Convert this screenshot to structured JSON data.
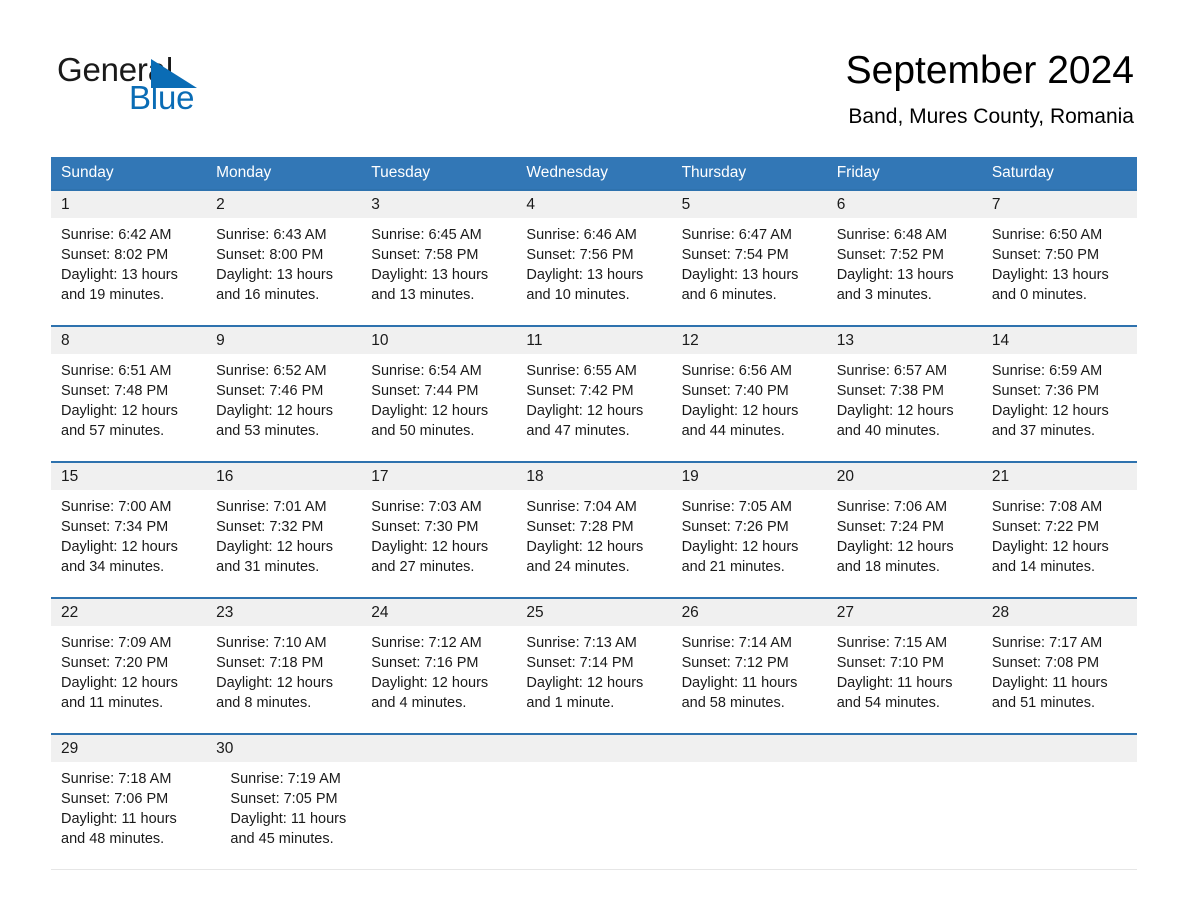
{
  "brand": {
    "name_part1": "General",
    "name_part2": "Blue",
    "triangle_color": "#0a6cb5"
  },
  "header": {
    "title": "September 2024",
    "subtitle": "Band, Mures County, Romania"
  },
  "theme": {
    "header_blue": "#3277b6",
    "rule_blue": "#2e72ae",
    "daynum_band": "#f0f0f0"
  },
  "weekdays": [
    "Sunday",
    "Monday",
    "Tuesday",
    "Wednesday",
    "Thursday",
    "Friday",
    "Saturday"
  ],
  "weeks": [
    {
      "days": [
        {
          "date": "1",
          "sunrise": "Sunrise: 6:42 AM",
          "sunset": "Sunset: 8:02 PM",
          "daylight_line1": "Daylight: 13 hours",
          "daylight_line2": "and 19 minutes."
        },
        {
          "date": "2",
          "sunrise": "Sunrise: 6:43 AM",
          "sunset": "Sunset: 8:00 PM",
          "daylight_line1": "Daylight: 13 hours",
          "daylight_line2": "and 16 minutes."
        },
        {
          "date": "3",
          "sunrise": "Sunrise: 6:45 AM",
          "sunset": "Sunset: 7:58 PM",
          "daylight_line1": "Daylight: 13 hours",
          "daylight_line2": "and 13 minutes."
        },
        {
          "date": "4",
          "sunrise": "Sunrise: 6:46 AM",
          "sunset": "Sunset: 7:56 PM",
          "daylight_line1": "Daylight: 13 hours",
          "daylight_line2": "and 10 minutes."
        },
        {
          "date": "5",
          "sunrise": "Sunrise: 6:47 AM",
          "sunset": "Sunset: 7:54 PM",
          "daylight_line1": "Daylight: 13 hours",
          "daylight_line2": "and 6 minutes."
        },
        {
          "date": "6",
          "sunrise": "Sunrise: 6:48 AM",
          "sunset": "Sunset: 7:52 PM",
          "daylight_line1": "Daylight: 13 hours",
          "daylight_line2": "and 3 minutes."
        },
        {
          "date": "7",
          "sunrise": "Sunrise: 6:50 AM",
          "sunset": "Sunset: 7:50 PM",
          "daylight_line1": "Daylight: 13 hours",
          "daylight_line2": "and 0 minutes."
        }
      ]
    },
    {
      "days": [
        {
          "date": "8",
          "sunrise": "Sunrise: 6:51 AM",
          "sunset": "Sunset: 7:48 PM",
          "daylight_line1": "Daylight: 12 hours",
          "daylight_line2": "and 57 minutes."
        },
        {
          "date": "9",
          "sunrise": "Sunrise: 6:52 AM",
          "sunset": "Sunset: 7:46 PM",
          "daylight_line1": "Daylight: 12 hours",
          "daylight_line2": "and 53 minutes."
        },
        {
          "date": "10",
          "sunrise": "Sunrise: 6:54 AM",
          "sunset": "Sunset: 7:44 PM",
          "daylight_line1": "Daylight: 12 hours",
          "daylight_line2": "and 50 minutes."
        },
        {
          "date": "11",
          "sunrise": "Sunrise: 6:55 AM",
          "sunset": "Sunset: 7:42 PM",
          "daylight_line1": "Daylight: 12 hours",
          "daylight_line2": "and 47 minutes."
        },
        {
          "date": "12",
          "sunrise": "Sunrise: 6:56 AM",
          "sunset": "Sunset: 7:40 PM",
          "daylight_line1": "Daylight: 12 hours",
          "daylight_line2": "and 44 minutes."
        },
        {
          "date": "13",
          "sunrise": "Sunrise: 6:57 AM",
          "sunset": "Sunset: 7:38 PM",
          "daylight_line1": "Daylight: 12 hours",
          "daylight_line2": "and 40 minutes."
        },
        {
          "date": "14",
          "sunrise": "Sunrise: 6:59 AM",
          "sunset": "Sunset: 7:36 PM",
          "daylight_line1": "Daylight: 12 hours",
          "daylight_line2": "and 37 minutes."
        }
      ]
    },
    {
      "days": [
        {
          "date": "15",
          "sunrise": "Sunrise: 7:00 AM",
          "sunset": "Sunset: 7:34 PM",
          "daylight_line1": "Daylight: 12 hours",
          "daylight_line2": "and 34 minutes."
        },
        {
          "date": "16",
          "sunrise": "Sunrise: 7:01 AM",
          "sunset": "Sunset: 7:32 PM",
          "daylight_line1": "Daylight: 12 hours",
          "daylight_line2": "and 31 minutes."
        },
        {
          "date": "17",
          "sunrise": "Sunrise: 7:03 AM",
          "sunset": "Sunset: 7:30 PM",
          "daylight_line1": "Daylight: 12 hours",
          "daylight_line2": "and 27 minutes."
        },
        {
          "date": "18",
          "sunrise": "Sunrise: 7:04 AM",
          "sunset": "Sunset: 7:28 PM",
          "daylight_line1": "Daylight: 12 hours",
          "daylight_line2": "and 24 minutes."
        },
        {
          "date": "19",
          "sunrise": "Sunrise: 7:05 AM",
          "sunset": "Sunset: 7:26 PM",
          "daylight_line1": "Daylight: 12 hours",
          "daylight_line2": "and 21 minutes."
        },
        {
          "date": "20",
          "sunrise": "Sunrise: 7:06 AM",
          "sunset": "Sunset: 7:24 PM",
          "daylight_line1": "Daylight: 12 hours",
          "daylight_line2": "and 18 minutes."
        },
        {
          "date": "21",
          "sunrise": "Sunrise: 7:08 AM",
          "sunset": "Sunset: 7:22 PM",
          "daylight_line1": "Daylight: 12 hours",
          "daylight_line2": "and 14 minutes."
        }
      ]
    },
    {
      "days": [
        {
          "date": "22",
          "sunrise": "Sunrise: 7:09 AM",
          "sunset": "Sunset: 7:20 PM",
          "daylight_line1": "Daylight: 12 hours",
          "daylight_line2": "and 11 minutes."
        },
        {
          "date": "23",
          "sunrise": "Sunrise: 7:10 AM",
          "sunset": "Sunset: 7:18 PM",
          "daylight_line1": "Daylight: 12 hours",
          "daylight_line2": "and 8 minutes."
        },
        {
          "date": "24",
          "sunrise": "Sunrise: 7:12 AM",
          "sunset": "Sunset: 7:16 PM",
          "daylight_line1": "Daylight: 12 hours",
          "daylight_line2": "and 4 minutes."
        },
        {
          "date": "25",
          "sunrise": "Sunrise: 7:13 AM",
          "sunset": "Sunset: 7:14 PM",
          "daylight_line1": "Daylight: 12 hours",
          "daylight_line2": "and 1 minute."
        },
        {
          "date": "26",
          "sunrise": "Sunrise: 7:14 AM",
          "sunset": "Sunset: 7:12 PM",
          "daylight_line1": "Daylight: 11 hours",
          "daylight_line2": "and 58 minutes."
        },
        {
          "date": "27",
          "sunrise": "Sunrise: 7:15 AM",
          "sunset": "Sunset: 7:10 PM",
          "daylight_line1": "Daylight: 11 hours",
          "daylight_line2": "and 54 minutes."
        },
        {
          "date": "28",
          "sunrise": "Sunrise: 7:17 AM",
          "sunset": "Sunset: 7:08 PM",
          "daylight_line1": "Daylight: 11 hours",
          "daylight_line2": "and 51 minutes."
        }
      ]
    },
    {
      "days": [
        {
          "date": "29",
          "sunrise": "Sunrise: 7:18 AM",
          "sunset": "Sunset: 7:06 PM",
          "daylight_line1": "Daylight: 11 hours",
          "daylight_line2": "and 48 minutes."
        },
        {
          "date": "30",
          "sunrise": "Sunrise: 7:19 AM",
          "sunset": "Sunset: 7:05 PM",
          "daylight_line1": "Daylight: 11 hours",
          "daylight_line2": "and 45 minutes."
        },
        {
          "date": "",
          "sunrise": "",
          "sunset": "",
          "daylight_line1": "",
          "daylight_line2": ""
        },
        {
          "date": "",
          "sunrise": "",
          "sunset": "",
          "daylight_line1": "",
          "daylight_line2": ""
        },
        {
          "date": "",
          "sunrise": "",
          "sunset": "",
          "daylight_line1": "",
          "daylight_line2": ""
        },
        {
          "date": "",
          "sunrise": "",
          "sunset": "",
          "daylight_line1": "",
          "daylight_line2": ""
        },
        {
          "date": "",
          "sunrise": "",
          "sunset": "",
          "daylight_line1": "",
          "daylight_line2": ""
        }
      ]
    }
  ]
}
